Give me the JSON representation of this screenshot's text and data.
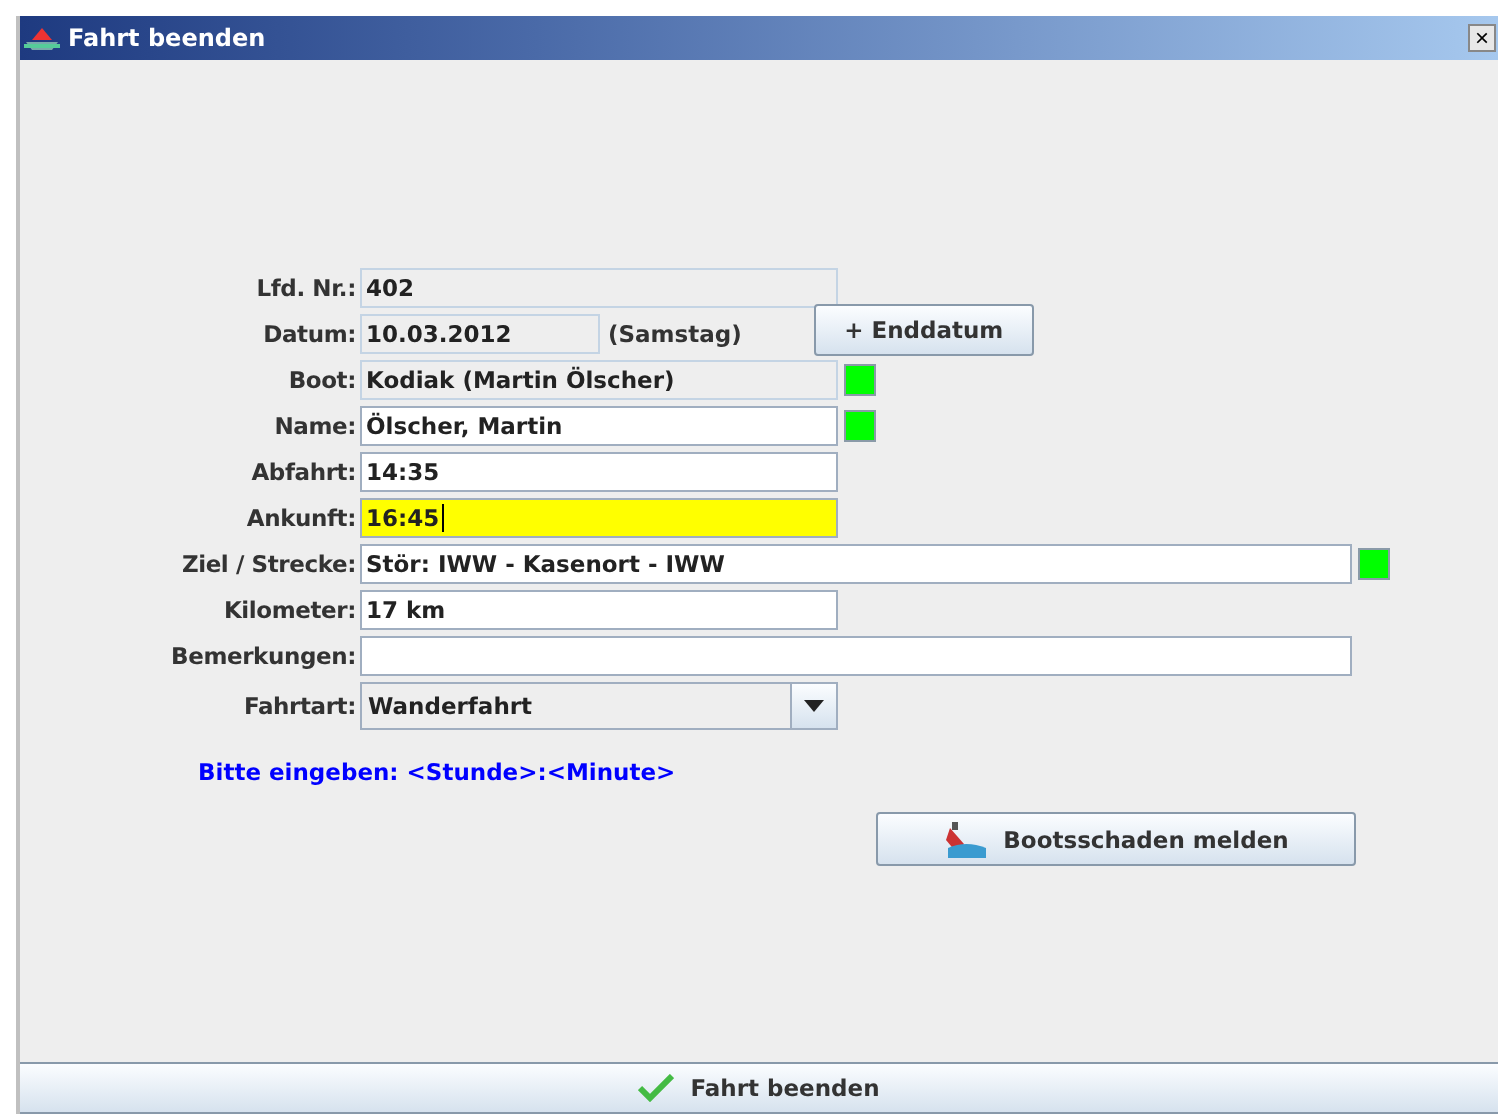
{
  "window": {
    "title": "Fahrt beenden",
    "close": "×"
  },
  "fields": [
    {
      "label": "Lfd. Nr.:",
      "kind": "readonly",
      "value": "402",
      "highlighted": false
    },
    {
      "label": "Datum:",
      "kind": "date",
      "value": "10.03.2012",
      "weekday": "(Samstag)",
      "button": "+ Enddatum",
      "highlighted": false
    },
    {
      "label": "Boot:",
      "kind": "readonly-bold",
      "value": "Kodiak (Martin Ölscher)",
      "highlighted": false,
      "color": "#00ff00"
    },
    {
      "label": "Name:",
      "kind": "input",
      "value": "Ölscher, Martin",
      "highlighted": false,
      "color": "#00ff00"
    },
    {
      "label": "Abfahrt:",
      "kind": "input",
      "value": "14:35",
      "highlighted": false
    },
    {
      "label": "Ankunft:",
      "kind": "input",
      "value": "16:45",
      "highlighted": true
    },
    {
      "label": "Ziel / Strecke:",
      "kind": "wide-input",
      "value": "Stör: IWW - Kasenort - IWW",
      "highlighted": false,
      "color": "#00ff00"
    },
    {
      "label": "Kilometer:",
      "kind": "input",
      "value": "17 km",
      "highlighted": false
    },
    {
      "label": "Bemerkungen:",
      "kind": "wide-input",
      "highlighted": false
    },
    {
      "label": "Fahrtart:",
      "kind": "combo",
      "value": "Wanderfahrt",
      "highlighted": false
    }
  ],
  "hint": "Bitte eingeben: <Stunde>:<Minute>",
  "damage_button": "Bootsschaden melden",
  "finish_button": "Fahrt beenden"
}
